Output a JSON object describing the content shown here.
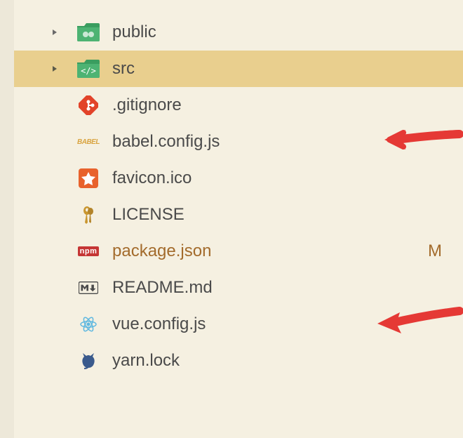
{
  "tree": {
    "items": [
      {
        "label": "public",
        "type": "folder",
        "expanded": false,
        "selected": false,
        "icon": "folder-public"
      },
      {
        "label": "src",
        "type": "folder",
        "expanded": false,
        "selected": true,
        "icon": "folder-src"
      },
      {
        "label": ".gitignore",
        "type": "file",
        "icon": "git"
      },
      {
        "label": "babel.config.js",
        "type": "file",
        "icon": "babel",
        "annotation": "arrow"
      },
      {
        "label": "favicon.ico",
        "type": "file",
        "icon": "favicon"
      },
      {
        "label": "LICENSE",
        "type": "file",
        "icon": "license"
      },
      {
        "label": "package.json",
        "type": "file",
        "icon": "npm",
        "status": "M",
        "modified": true
      },
      {
        "label": "README.md",
        "type": "file",
        "icon": "markdown"
      },
      {
        "label": "vue.config.js",
        "type": "file",
        "icon": "react",
        "annotation": "arrow"
      },
      {
        "label": "yarn.lock",
        "type": "file",
        "icon": "yarn"
      }
    ]
  },
  "icons": {
    "babel_text": "BABEL",
    "npm_text": "npm"
  }
}
